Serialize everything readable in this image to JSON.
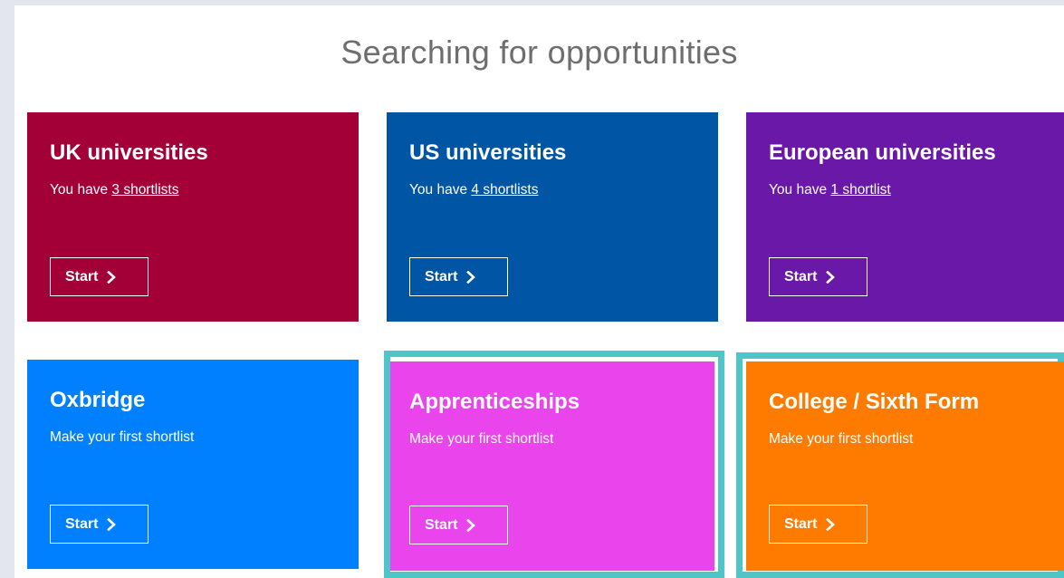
{
  "page": {
    "title": "Searching for opportunities"
  },
  "cards": [
    {
      "id": "uk",
      "title": "UK universities",
      "subtitle_prefix": "You have ",
      "subtitle_link": "3 shortlists",
      "button": "Start",
      "color": "#a30037"
    },
    {
      "id": "us",
      "title": "US universities",
      "subtitle_prefix": "You have ",
      "subtitle_link": "4 shortlists",
      "button": "Start",
      "color": "#0055a5"
    },
    {
      "id": "european",
      "title": "European universities",
      "subtitle_prefix": "You have ",
      "subtitle_link": "1 shortlist",
      "button": "Start",
      "color": "#6a18a8"
    },
    {
      "id": "oxbridge",
      "title": "Oxbridge",
      "subtitle": "Make your first shortlist",
      "button": "Start",
      "color": "#0080ff"
    },
    {
      "id": "apprenticeships",
      "title": "Apprenticeships",
      "subtitle": "Make your first shortlist",
      "button": "Start",
      "color": "#ea44ed",
      "highlighted": true
    },
    {
      "id": "college",
      "title": "College / Sixth Form",
      "subtitle": "Make your first shortlist",
      "button": "Start",
      "color": "#ff7b00",
      "highlighted": true
    }
  ],
  "colors": {
    "highlight_border": "#4ec6c8",
    "page_background": "#e3e6ee",
    "panel_background": "#ffffff",
    "title_text": "#6e6e6e"
  },
  "icons": {
    "button_icon": "chevron-right-icon"
  }
}
